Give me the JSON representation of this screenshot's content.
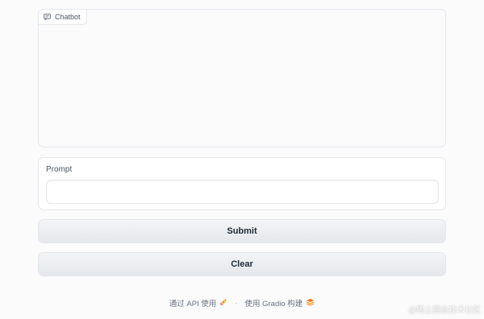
{
  "chatbot": {
    "label": "Chatbot",
    "icon": "chat-icon"
  },
  "prompt": {
    "label": "Prompt",
    "value": "",
    "placeholder": ""
  },
  "buttons": {
    "submit": "Submit",
    "clear": "Clear"
  },
  "footer": {
    "api_link": "通过 API 使用",
    "api_icon": "rocket-icon",
    "separator": "·",
    "gradio_link": "使用 Gradio 构建",
    "gradio_icon": "gradio-logo-icon"
  },
  "watermark": "@稀土掘金技术社区",
  "colors": {
    "background": "#fbfbfc",
    "border": "#e5e7eb",
    "button_bg": "#e5e7eb",
    "text": "#1f2937"
  }
}
